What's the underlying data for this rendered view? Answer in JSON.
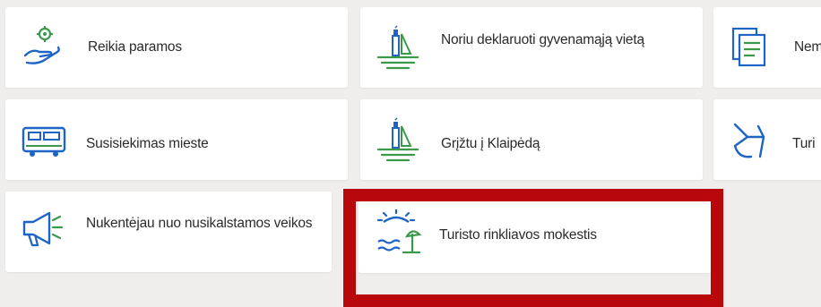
{
  "tiles": [
    {
      "label": "Reikia paramos",
      "icon": "hand-gear-icon"
    },
    {
      "label": "Noriu deklaruoti gyvenamąją vietą",
      "icon": "lighthouse-icon"
    },
    {
      "label": "Nem",
      "icon": "document-icon"
    },
    {
      "label": "Susisiekimas mieste",
      "icon": "bus-icon"
    },
    {
      "label": "Grįžtu į Klaipėdą",
      "icon": "lighthouse-icon"
    },
    {
      "label": "Turi",
      "icon": "route-icon"
    },
    {
      "label": "Nukentėjau nuo nusikalstamos veikos",
      "icon": "megaphone-icon"
    },
    {
      "label": "Turisto rinkliavos mokestis",
      "icon": "beach-sun-icon"
    }
  ],
  "colors": {
    "icon_blue": "#1e63c6",
    "icon_green": "#3a9a4a",
    "highlight_red": "#b8080b",
    "background": "#efeeec"
  }
}
